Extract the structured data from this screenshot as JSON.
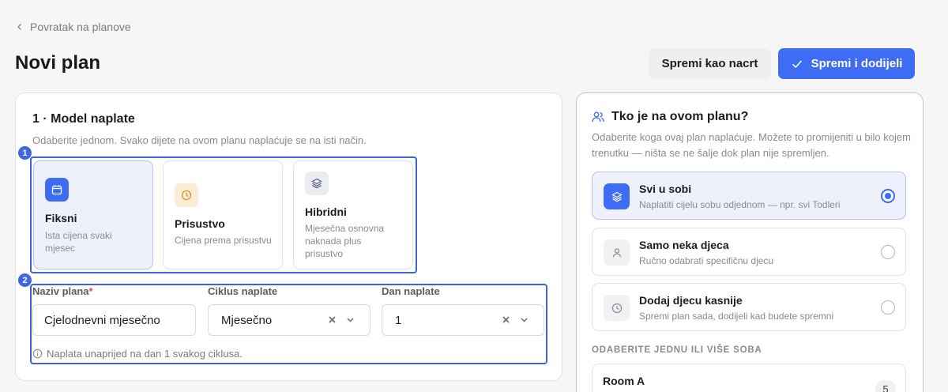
{
  "nav": {
    "back_label": "Povratak na planove"
  },
  "page": {
    "title": "Novi plan"
  },
  "actions": {
    "draft_label": "Spremi kao nacrt",
    "save_label": "Spremi i dodijeli"
  },
  "billing_model": {
    "section_title": "1 · Model naplate",
    "section_subtitle": "Odaberite jednom. Svako dijete na ovom planu naplaćuje se na isti način.",
    "step_badge": "1",
    "options": [
      {
        "title": "Fiksni",
        "description": "Ista cijena svaki mjesec",
        "icon": "calendar-icon",
        "selected": true
      },
      {
        "title": "Prisustvo",
        "description": "Cijena prema prisustvu",
        "icon": "clock-icon",
        "selected": false
      },
      {
        "title": "Hibridni",
        "description": "Mjesečna osnovna naknada plus prisustvo",
        "icon": "layers-icon",
        "selected": false
      }
    ]
  },
  "plan_fields": {
    "step_badge": "2",
    "name_label": "Naziv plana",
    "required_mark": "*",
    "name_value": "Cjelodnevni mjesečno",
    "cycle_label": "Ciklus naplate",
    "cycle_value": "Mjesečno",
    "day_label": "Dan naplate",
    "day_value": "1",
    "hint": "Naplata unaprijed na dan 1 svakog ciklusa."
  },
  "assignment": {
    "title": "Tko je na ovom planu?",
    "subtitle": "Odaberite koga ovaj plan naplaćuje. Možete to promijeniti u bilo kojem trenutku — ništa se ne šalje dok plan nije spremljen.",
    "options": [
      {
        "title": "Svi u sobi",
        "description": "Naplatiti cijelu sobu odjednom — npr. svi Todleri",
        "icon": "layers-icon",
        "selected": true
      },
      {
        "title": "Samo neka djeca",
        "description": "Ručno odabrati specifičnu djecu",
        "icon": "person-icon",
        "selected": false
      },
      {
        "title": "Dodaj djecu kasnije",
        "description": "Spremi plan sada, dodijeli kad budete spremni",
        "icon": "clock-icon",
        "selected": false
      }
    ],
    "rooms_heading": "ODABERITE JEDNU ILI VIŠE SOBA",
    "rooms": [
      {
        "name": "Room A",
        "count": "5"
      }
    ]
  },
  "colors": {
    "accent": "#3f6cf4",
    "highlight_border": "#3e62de",
    "selected_bg": "#eef1fb",
    "required": "#e04848"
  }
}
